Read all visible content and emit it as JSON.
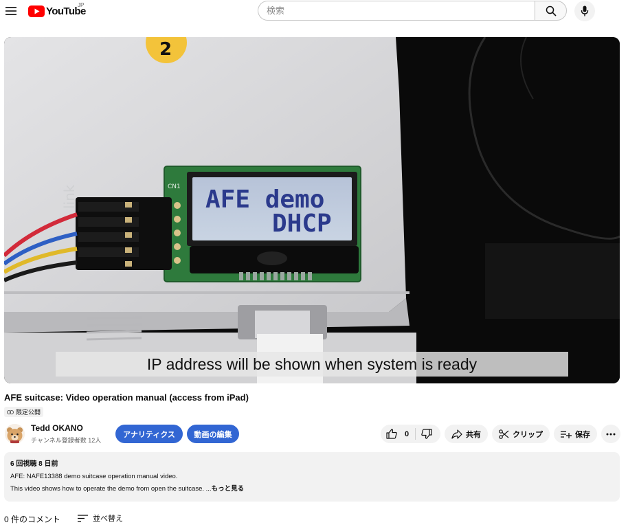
{
  "header": {
    "logo_text": "YouTube",
    "region": "JP",
    "search_placeholder": "検索"
  },
  "video": {
    "lcd_line1": "AFE demo",
    "lcd_line2": "DHCP",
    "pcb_label": "CN1",
    "sticker_label": "2",
    "caption": "IP address will be shown when system is ready"
  },
  "title": "AFE suitcase: Video operation manual (access from iPad)",
  "visibility_badge": "限定公開",
  "channel": {
    "name": "Tedd OKANO",
    "subscribers": "チャンネル登録者数 12人"
  },
  "actions": {
    "analytics": "アナリティクス",
    "edit": "動画の編集",
    "like_count": "0",
    "share": "共有",
    "clip": "クリップ",
    "save": "保存"
  },
  "description": {
    "meta": "6 回視聴  8 日前",
    "line1": "AFE: NAFE13388 demo suitcase operation manual video.",
    "line2": "This video shows how to operate the demo from open the suitcase. ...",
    "more": "もっと見る"
  },
  "comments": {
    "count": "0 件のコメント",
    "sort": "並べ替え"
  },
  "colors": {
    "brand_red": "#ff0000",
    "button_blue": "#3266d3",
    "chip_gray": "#f2f2f2"
  }
}
